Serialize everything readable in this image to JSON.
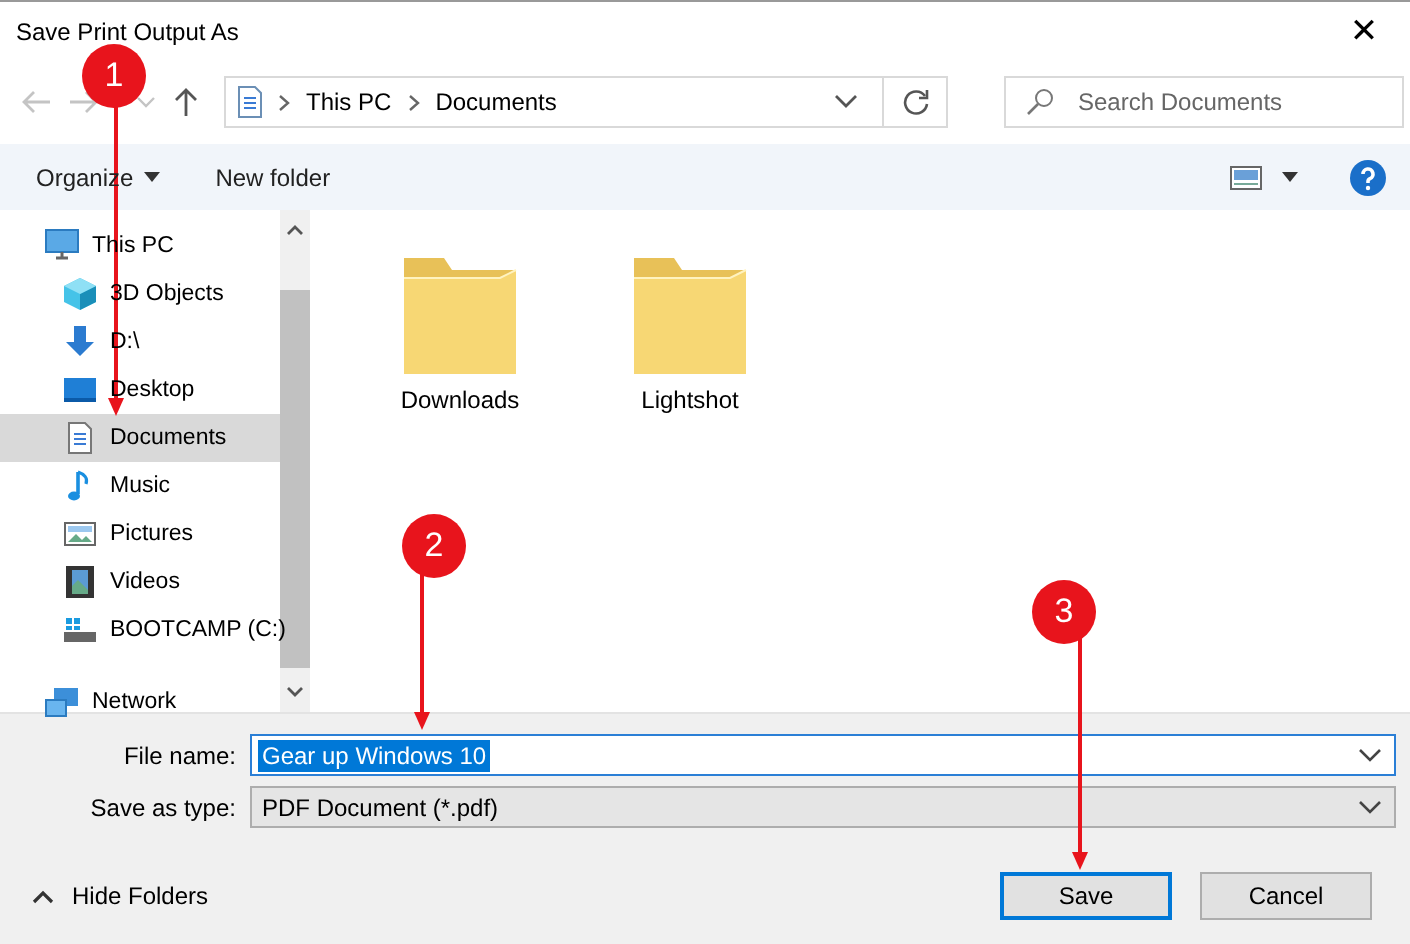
{
  "window": {
    "title": "Save Print Output As",
    "close": "✕"
  },
  "nav": {
    "path": [
      {
        "label": "This PC"
      },
      {
        "label": "Documents"
      }
    ],
    "search": {
      "placeholder": "Search Documents"
    }
  },
  "toolbar": {
    "organize": "Organize",
    "new_folder": "New folder"
  },
  "sidebar": {
    "items": [
      {
        "label": "This PC",
        "kind": "pc",
        "selected": false,
        "children": [
          {
            "label": "3D Objects",
            "kind": "cube",
            "selected": false
          },
          {
            "label": "D:\\",
            "kind": "download",
            "selected": false
          },
          {
            "label": "Desktop",
            "kind": "desktop",
            "selected": false
          },
          {
            "label": "Documents",
            "kind": "doc",
            "selected": true
          },
          {
            "label": "Music",
            "kind": "music",
            "selected": false
          },
          {
            "label": "Pictures",
            "kind": "pictures",
            "selected": false
          },
          {
            "label": "Videos",
            "kind": "video",
            "selected": false
          },
          {
            "label": "BOOTCAMP (C:)",
            "kind": "drive",
            "selected": false
          }
        ]
      },
      {
        "label": "Network",
        "kind": "network",
        "selected": false
      }
    ]
  },
  "folders": [
    {
      "label": "Downloads"
    },
    {
      "label": "Lightshot"
    }
  ],
  "form": {
    "file_name": {
      "label": "File name:",
      "value": "Gear up Windows 10"
    },
    "save_as_type": {
      "label": "Save as type:",
      "value": "PDF Document (*.pdf)"
    }
  },
  "hide_folders": "Hide Folders",
  "buttons": [
    {
      "label": "Save",
      "kind": "default"
    },
    {
      "label": "Cancel",
      "kind": "normal"
    }
  ],
  "annotations": [
    {
      "label": "1"
    },
    {
      "label": "2"
    },
    {
      "label": "3"
    }
  ]
}
